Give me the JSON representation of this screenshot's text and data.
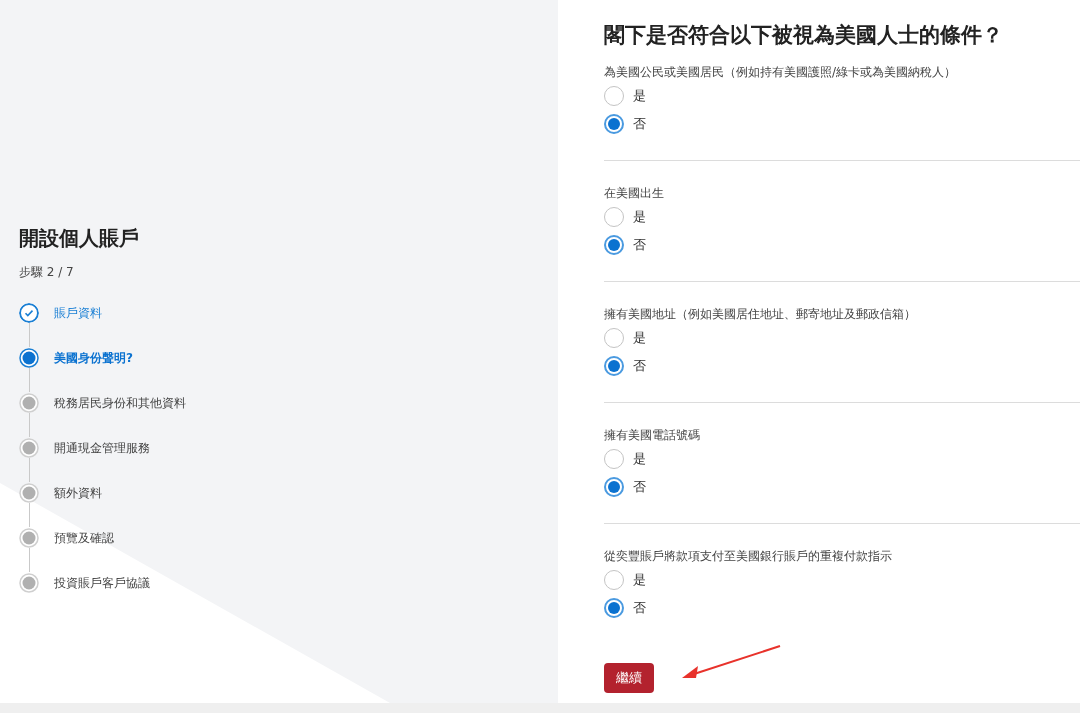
{
  "sidebar": {
    "title": "開設個人賬戶",
    "step_counter": "步驟 2 / 7",
    "steps": [
      {
        "label": "賬戶資料",
        "kind": "done"
      },
      {
        "label": "美國身份聲明?",
        "kind": "current"
      },
      {
        "label": "稅務居民身份和其他資料",
        "kind": "pending"
      },
      {
        "label": "開通現金管理服務",
        "kind": "pending"
      },
      {
        "label": "額外資料",
        "kind": "pending"
      },
      {
        "label": "預覽及確認",
        "kind": "pending"
      },
      {
        "label": "投資賬戶客戶協議",
        "kind": "pending"
      }
    ]
  },
  "form": {
    "heading": "閣下是否符合以下被視為美國人士的條件？",
    "questions": [
      {
        "label": "為美國公民或美國居民（例如持有美國護照/綠卡或為美國納稅人）",
        "options": [
          {
            "label": "是",
            "selected": false
          },
          {
            "label": "否",
            "selected": true
          }
        ]
      },
      {
        "label": "在美國出生",
        "options": [
          {
            "label": "是",
            "selected": false
          },
          {
            "label": "否",
            "selected": true
          }
        ]
      },
      {
        "label": "擁有美國地址（例如美國居住地址、郵寄地址及郵政信箱）",
        "options": [
          {
            "label": "是",
            "selected": false
          },
          {
            "label": "否",
            "selected": true
          }
        ]
      },
      {
        "label": "擁有美國電話號碼",
        "options": [
          {
            "label": "是",
            "selected": false
          },
          {
            "label": "否",
            "selected": true
          }
        ]
      },
      {
        "label": "從奕豐賬戶將款項支付至美國銀行賬戶的重複付款指示",
        "options": [
          {
            "label": "是",
            "selected": false
          },
          {
            "label": "否",
            "selected": true
          }
        ]
      }
    ],
    "continue_button": "繼續"
  }
}
